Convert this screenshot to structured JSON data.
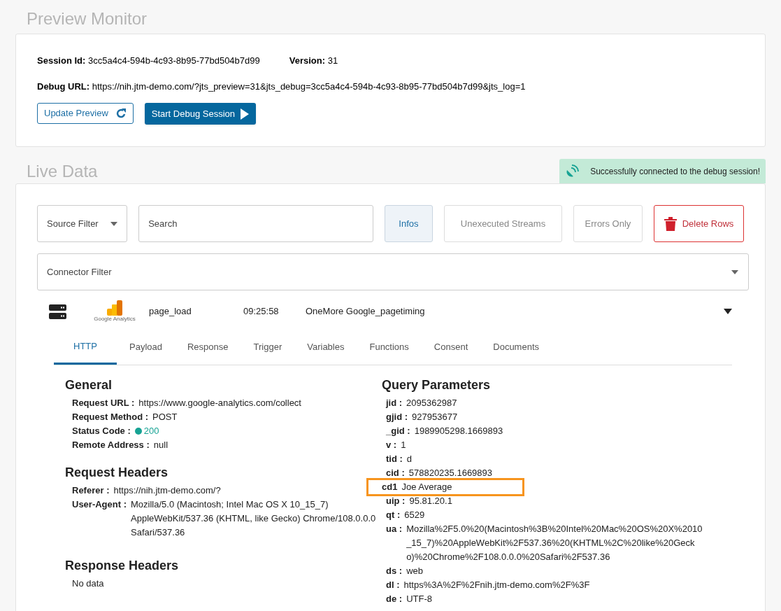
{
  "preview_monitor": {
    "title": "Preview Monitor",
    "session_id": {
      "label": "Session Id:",
      "value": "3cc5a4c4-594b-4c93-8b95-77bd504b7d99"
    },
    "version": {
      "label": "Version:",
      "value": "31"
    },
    "debug_url": {
      "label": "Debug URL:",
      "value": "https://nih.jtm-demo.com/?jts_preview=31&jts_debug=3cc5a4c4-594b-4c93-8b95-77bd504b7d99&jts_log=1"
    },
    "buttons": [
      {
        "label": "Update Preview",
        "kind": "outline"
      },
      {
        "label": "Start Debug Session",
        "kind": "primary"
      }
    ]
  },
  "live_data": {
    "title": "Live Data",
    "toast": "Successfully connected to the debug session!",
    "source_filter": {
      "placeholder": "Source Filter"
    },
    "search": {
      "placeholder": "Search"
    },
    "filters": [
      {
        "label": "Infos",
        "kind": "toggle",
        "selected": true
      },
      {
        "label": "Unexecuted Streams",
        "kind": "toggle",
        "selected": false
      },
      {
        "label": "Errors Only",
        "kind": "toggle",
        "selected": false
      },
      {
        "label": "Delete Rows",
        "kind": "danger"
      }
    ],
    "connector_filter": {
      "placeholder": "Connector Filter"
    },
    "event": {
      "logo_caption": "Google Analytics",
      "name": "page_load",
      "time": "09:25:58",
      "description": "OneMore Google_pagetiming",
      "expanded": true
    },
    "tabs": [
      {
        "label": "HTTP",
        "selected": true
      },
      {
        "label": "Payload",
        "selected": false
      },
      {
        "label": "Response",
        "selected": false
      },
      {
        "label": "Trigger",
        "selected": false
      },
      {
        "label": "Variables",
        "selected": false
      },
      {
        "label": "Functions",
        "selected": false
      },
      {
        "label": "Consent",
        "selected": false
      },
      {
        "label": "Documents",
        "selected": false
      }
    ],
    "general": {
      "title": "General",
      "rows": [
        {
          "label": "Request URL :",
          "value": "https://www.google-analytics.com/collect"
        },
        {
          "label": "Request Method :",
          "value": "POST"
        },
        {
          "label": "Status Code :",
          "value": "200",
          "color": "#17a394"
        },
        {
          "label": "Remote Address :",
          "value": "null"
        }
      ]
    },
    "request_headers": {
      "title": "Request Headers",
      "rows": [
        {
          "label": "Referer :",
          "value": "https://nih.jtm-demo.com/?"
        },
        {
          "label": "User-Agent :",
          "value": "Mozilla/5.0 (Macintosh; Intel Mac OS X 10_15_7) AppleWebKit/537.36 (KHTML, like Gecko) Chrome/108.0.0.0 Safari/537.36"
        }
      ]
    },
    "response_headers": {
      "title": "Response Headers",
      "empty": "No data"
    },
    "query_parameters": {
      "title": "Query Parameters",
      "rows": [
        {
          "label": "jid :",
          "value": "2095362987",
          "highlighted": false
        },
        {
          "label": "gjid :",
          "value": "927953677",
          "highlighted": false
        },
        {
          "label": "_gid :",
          "value": "1989905298.1669893",
          "highlighted": false
        },
        {
          "label": "v :",
          "value": "1",
          "highlighted": false
        },
        {
          "label": "tid :",
          "value": "d",
          "highlighted": false
        },
        {
          "label": "cid :",
          "value": "578820235.1669893",
          "highlighted": false
        },
        {
          "label": "cd1",
          "value": "Joe Average",
          "highlighted": true
        },
        {
          "label": "uip :",
          "value": "95.81.20.1",
          "highlighted": false
        },
        {
          "label": "qt :",
          "value": "6529",
          "highlighted": false
        },
        {
          "label": "ua :",
          "value": "Mozilla%2F5.0%20(Macintosh%3B%20Intel%20Mac%20OS%20X%2010_15_7)%20AppleWebKit%2F537.36%20(KHTML%2C%20like%20Gecko)%20Chrome%2F108.0.0.0%20Safari%2F537.36",
          "highlighted": false
        },
        {
          "label": "ds :",
          "value": "web",
          "highlighted": false
        },
        {
          "label": "dl :",
          "value": "https%3A%2F%2Fnih.jtm-demo.com%2F%3F",
          "highlighted": false
        },
        {
          "label": "de :",
          "value": "UTF-8",
          "highlighted": false
        }
      ]
    }
  }
}
